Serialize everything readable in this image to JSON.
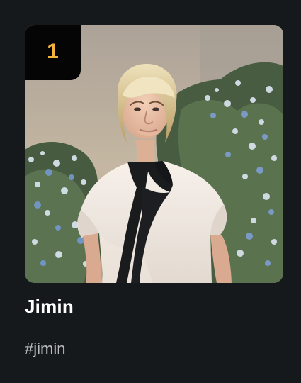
{
  "rank_card": {
    "rank": "1",
    "name": "Jimin",
    "hashtag": "#jimin",
    "photo_icon": "artist-photo",
    "colors": {
      "background": "#16191c",
      "badge": "#050505",
      "rank": "#f2b33d",
      "name": "#ffffff",
      "hashtag": "#b9bcbf"
    }
  }
}
